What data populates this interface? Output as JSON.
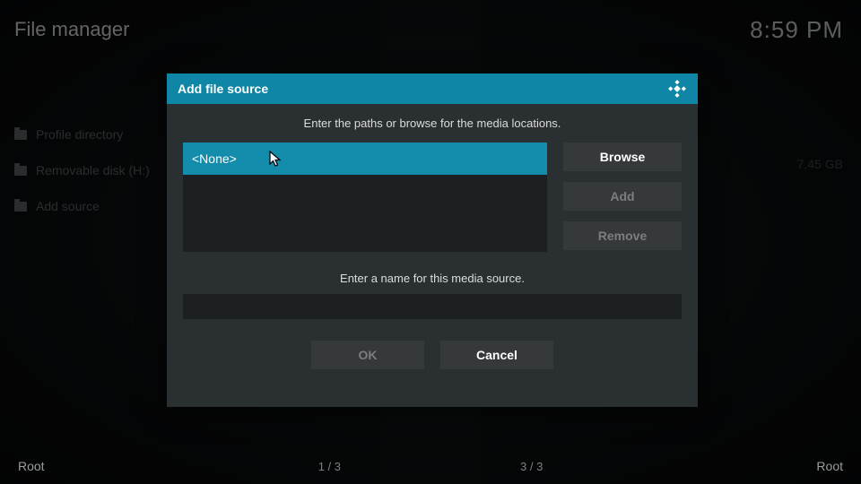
{
  "header": {
    "title": "File manager",
    "clock": "8:59 PM"
  },
  "sidebar": {
    "items": [
      {
        "label": "Profile directory"
      },
      {
        "label": "Removable disk (H:)",
        "size": "7.45 GB"
      },
      {
        "label": "Add source"
      }
    ]
  },
  "footer": {
    "left_label": "Root",
    "right_label": "Root",
    "left_count": "1 / 3",
    "right_count": "3 / 3"
  },
  "dialog": {
    "title": "Add file source",
    "instruction_paths": "Enter the paths or browse for the media locations.",
    "path_value": "<None>",
    "browse_label": "Browse",
    "add_label": "Add",
    "remove_label": "Remove",
    "instruction_name": "Enter a name for this media source.",
    "name_value": "",
    "ok_label": "OK",
    "cancel_label": "Cancel"
  }
}
